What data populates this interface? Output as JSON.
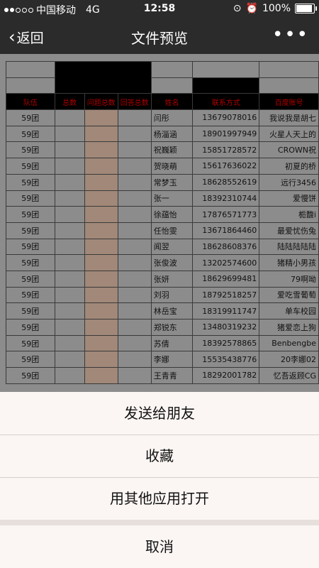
{
  "status": {
    "carrier": "中国移动",
    "network": "4G",
    "time": "12:58",
    "battery": "100%"
  },
  "nav": {
    "back_label": "返回",
    "title": "文件预览",
    "more": "•••"
  },
  "sheet": {
    "headers": [
      "队伍",
      "总数",
      "问题总数",
      "回答总数",
      "姓名",
      "联系方式",
      "百度账号"
    ],
    "rows": [
      [
        "59团",
        "",
        "",
        "",
        "闫彤",
        "13679078016",
        "我说我是胡七"
      ],
      [
        "59团",
        "",
        "",
        "",
        "杨淄涵",
        "18901997949",
        "火星人天上的"
      ],
      [
        "59团",
        "",
        "",
        "",
        "祝巍颖",
        "15851728572",
        "CROWN祝"
      ],
      [
        "59团",
        "",
        "",
        "",
        "贺晓萌",
        "15617636022",
        "初夏的桥"
      ],
      [
        "59团",
        "",
        "",
        "",
        "常梦玉",
        "18628552619",
        "远行3456"
      ],
      [
        "59团",
        "",
        "",
        "",
        "张一",
        "18392310744",
        "爱慢饼"
      ],
      [
        "59团",
        "",
        "",
        "",
        "徐蕴怡",
        "17876571773",
        "栀馥i"
      ],
      [
        "59团",
        "",
        "",
        "",
        "任怡雯",
        "13671864460",
        "最爱忧伤兔"
      ],
      [
        "59团",
        "",
        "",
        "",
        "闻翌",
        "18628608376",
        "陆陆陆陆陆"
      ],
      [
        "59团",
        "",
        "",
        "",
        "张俊波",
        "13202574600",
        "猪精小男孩"
      ],
      [
        "59团",
        "",
        "",
        "",
        "张妍",
        "18629699481",
        "79啊呦"
      ],
      [
        "59团",
        "",
        "",
        "",
        "刘羽",
        "18792518257",
        "爱吃雪葡萄"
      ],
      [
        "59团",
        "",
        "",
        "",
        "林岳宝",
        "18319911747",
        "单车校园"
      ],
      [
        "59团",
        "",
        "",
        "",
        "郑锐东",
        "13480319232",
        "猪爱恋上狗"
      ],
      [
        "59团",
        "",
        "",
        "",
        "苏倩",
        "18392578865",
        "Benbengbe"
      ],
      [
        "59团",
        "",
        "",
        "",
        "李娜",
        "15535438776",
        "20李娜02"
      ],
      [
        "59团",
        "",
        "",
        "",
        "王青青",
        "18292001782",
        "忆吾返顾CG"
      ]
    ]
  },
  "actions": {
    "send": "发送给朋友",
    "favorite": "收藏",
    "open_with": "用其他应用打开",
    "cancel": "取消"
  }
}
